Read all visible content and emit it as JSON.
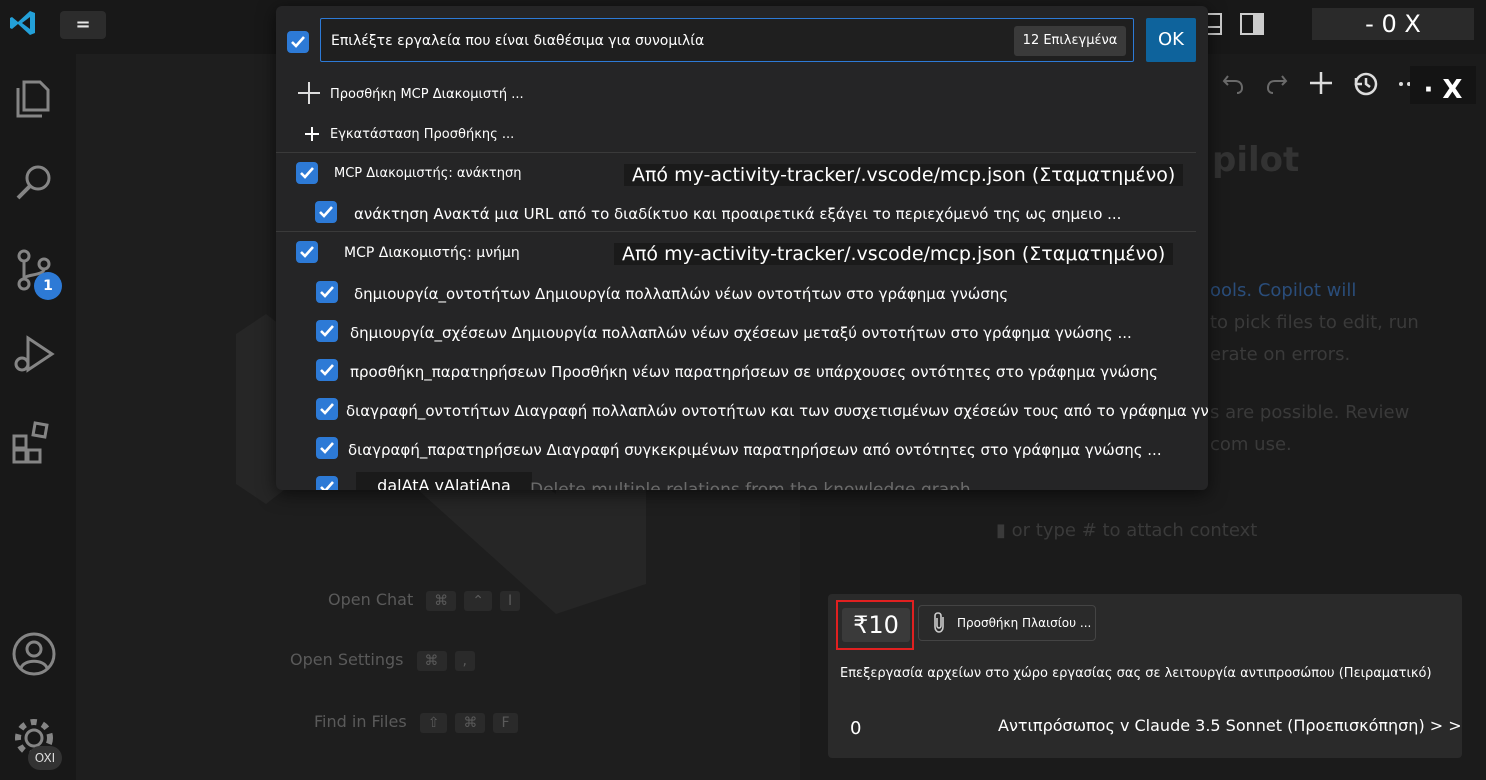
{
  "titlebar": {
    "menu_label": "=",
    "window_controls": "- 0 X"
  },
  "activity": {
    "scm_badge": "1",
    "settings_badge": "OXI"
  },
  "quickpick": {
    "input_text": "Επιλέξτε εργαλεία που είναι διαθέσιμα για συνομιλία",
    "selected_count": "12 Επιλεγμένα",
    "ok_label": "OK",
    "actions": {
      "add_server": "Προσθήκη MCP Διακομιστή ...",
      "install_extension": "Εγκατάσταση Προσθήκης ..."
    },
    "groups": [
      {
        "label": "MCP Διακομιστής: ανάκτηση",
        "source": "Από my-activity-tracker/.vscode/mcp.json (Σταματημένο)",
        "tools": [
          "ανάκτηση Ανακτά μια URL από το διαδίκτυο και προαιρετικά εξάγει το περιεχόμενό της ως σημειο ..."
        ]
      },
      {
        "label": "MCP Διακομιστής: μνήμη",
        "source": "Από my-activity-tracker/.vscode/mcp.json (Σταματημένο)",
        "tools": [
          "δημιουργία_οντοτήτων Δημιουργία πολλαπλών νέων οντοτήτων στο γράφημα γνώσης",
          "δημιουργία_σχέσεων Δημιουργία πολλαπλών νέων σχέσεων μεταξύ οντοτήτων στο γράφημα γνώσης ...",
          "προσθήκη_παρατηρήσεων Προσθήκη νέων παρατηρήσεων σε υπάρχουσες οντότητες στο γράφημα γνώσης",
          "διαγραφή_οντοτήτων Διαγραφή πολλαπλών οντοτήτων και των συσχετισμένων σχέσεών τους από το γράφημα γν...",
          "διαγραφή_παρατηρήσεων Διαγραφή συγκεκριμένων παρατηρήσεων από οντότητες στο γράφημα γνώσης ..."
        ],
        "partial_label": "dalAtA vAlatiAna",
        "partial_faded": "Delete multiple relations from the knowledge graph"
      }
    ]
  },
  "chat": {
    "counter": "₹10",
    "attach_label": "Προσθήκη Πλαισίου ...",
    "mode_text": "Επεξεργασία αρχείων στο χώρο εργασίας σας σε λειτουργία αντιπροσώπου (Πειραματικό)",
    "mode_zero": "0",
    "agent_text": "Αντιπρόσωπος v Claude 3.5 Sonnet (Προεπισκόπηση) > >",
    "close_label": "· X"
  },
  "colors": {
    "accent": "#2d7ad6",
    "highlight_border": "#e02020",
    "ok_button": "#0e639c"
  }
}
